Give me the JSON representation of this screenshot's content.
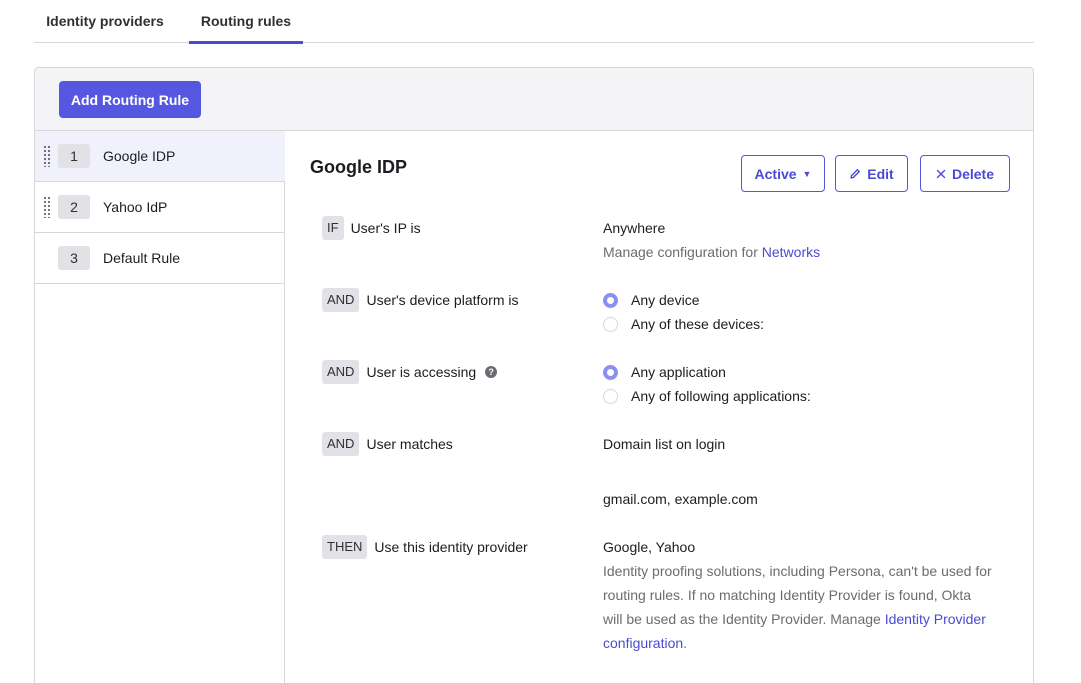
{
  "tabs": [
    {
      "label": "Identity providers",
      "active": false
    },
    {
      "label": "Routing rules",
      "active": true
    }
  ],
  "toolbar": {
    "add_label": "Add Routing Rule"
  },
  "rules": [
    {
      "number": "1",
      "name": "Google IDP",
      "active": true
    },
    {
      "number": "2",
      "name": "Yahoo IdP",
      "active": false
    },
    {
      "number": "3",
      "name": "Default Rule",
      "active": false
    }
  ],
  "detail": {
    "title": "Google IDP",
    "status_label": "Active",
    "status_caret": "▼",
    "edit_label": "Edit",
    "delete_label": "Delete",
    "conditions": {
      "ip": {
        "operator": "IF",
        "label": "User's IP is",
        "value": "Anywhere",
        "manage_prefix": "Manage configuration for",
        "manage_link": "Networks"
      },
      "platform": {
        "operator": "AND",
        "label": "User's device platform is",
        "options": [
          "Any device",
          "Any of these devices:"
        ],
        "selected_index": 0
      },
      "accessing": {
        "operator": "AND",
        "label": "User is accessing",
        "help_glyph": "?",
        "options": [
          "Any application",
          "Any of following applications:"
        ],
        "selected_index": 0
      },
      "matches": {
        "operator": "AND",
        "label": "User matches",
        "value": "Domain list on login",
        "domains": "gmail.com, example.com"
      },
      "then": {
        "operator": "THEN",
        "label": "Use this identity provider",
        "value": "Google, Yahoo",
        "note": "Identity proofing solutions, including Persona, can't be used for routing rules. If no matching Identity Provider is found, Okta will be used as the Identity Provider. Manage",
        "note_link": "Identity Provider configuration",
        "note_suffix": "."
      }
    }
  },
  "colors": {
    "accent": "#5557e0",
    "link": "#4a4ad6",
    "radio_selected": "#8d8ff0",
    "border": "#d7d7dc",
    "badge_bg": "#e1e1e6",
    "header_bg": "#f4f4f6",
    "active_row_bg": "#f1f1fb"
  }
}
